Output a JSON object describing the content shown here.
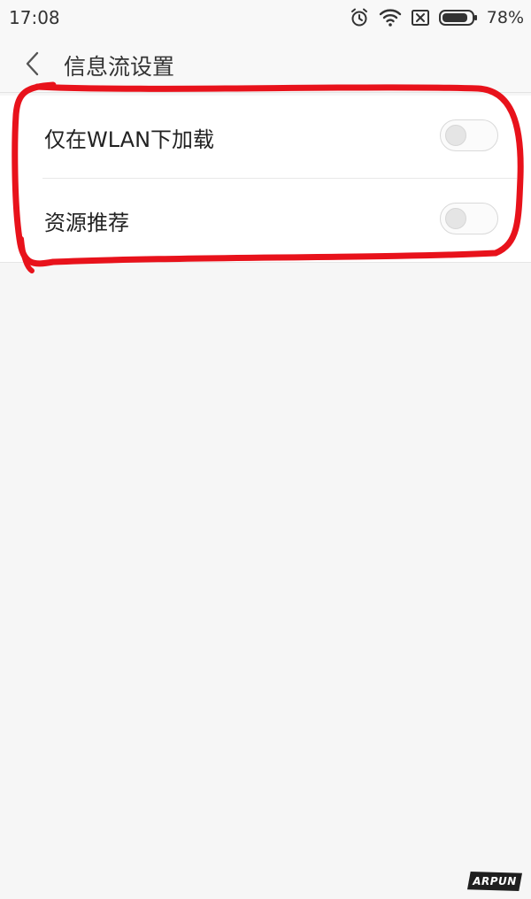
{
  "status_bar": {
    "time": "17:08",
    "battery_percent": "78%",
    "icons": [
      "alarm-icon",
      "wifi-icon",
      "sim-blocked-icon",
      "battery-icon"
    ]
  },
  "header": {
    "back_icon": "chevron-left-icon",
    "title": "信息流设置"
  },
  "settings": {
    "items": [
      {
        "label": "仅在WLAN下加载",
        "enabled": false
      },
      {
        "label": "资源推荐",
        "enabled": false
      }
    ]
  },
  "annotation": {
    "color": "#e8121b"
  },
  "watermark": {
    "text": "ARPUN"
  },
  "colors": {
    "background": "#f6f6f6",
    "card": "#ffffff",
    "toggle_off": "#e5e5e5"
  }
}
